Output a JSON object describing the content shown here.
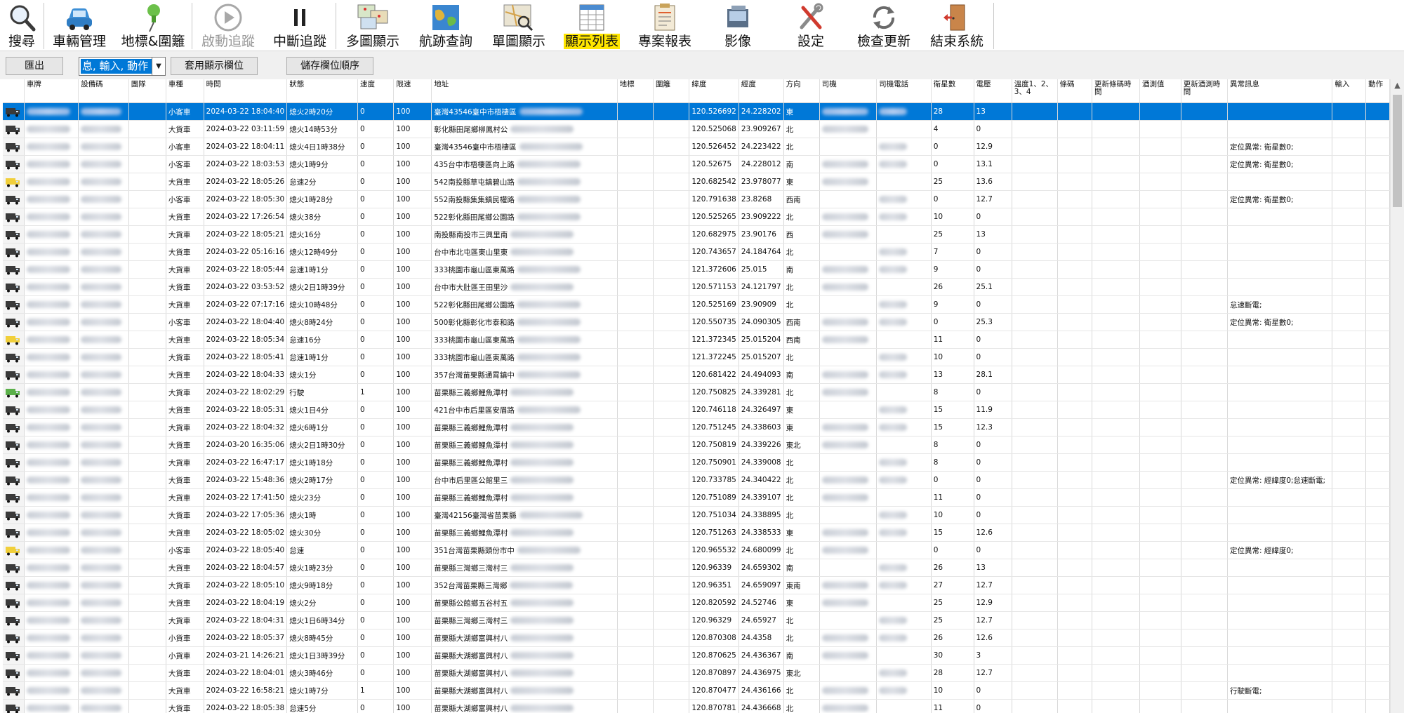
{
  "toolbar": {
    "buttons": [
      {
        "label": "搜尋",
        "icon": "search-icon",
        "state": "normal"
      },
      {
        "label": "車輛管理",
        "icon": "car-icon",
        "state": "normal"
      },
      {
        "label": "地標&圍籬",
        "icon": "pushpin-icon",
        "state": "normal"
      },
      {
        "label": "啟動追蹤",
        "icon": "play-icon",
        "state": "disabled"
      },
      {
        "label": "中斷追蹤",
        "icon": "pause-icon",
        "state": "normal"
      },
      {
        "label": "多圖顯示",
        "icon": "multi-map-icon",
        "state": "normal"
      },
      {
        "label": "航跡查詢",
        "icon": "globe-icon",
        "state": "normal"
      },
      {
        "label": "單圖顯示",
        "icon": "map-search-icon",
        "state": "normal"
      },
      {
        "label": "顯示列表",
        "icon": "table-icon",
        "state": "active"
      },
      {
        "label": "專案報表",
        "icon": "report-icon",
        "state": "normal"
      },
      {
        "label": "影像",
        "icon": "image-icon",
        "state": "normal"
      },
      {
        "label": "設定",
        "icon": "tools-icon",
        "state": "normal"
      },
      {
        "label": "檢查更新",
        "icon": "refresh-icon",
        "state": "normal"
      },
      {
        "label": "結束系統",
        "icon": "exit-door-icon",
        "state": "normal"
      }
    ],
    "accent_color": "#ffe600"
  },
  "subbar": {
    "export_label": "匯出",
    "column_select_value": "息, 輸入, 動作",
    "apply_columns_label": "套用顯示欄位",
    "save_order_label": "儲存欄位順序"
  },
  "grid": {
    "selection_color": "#0078d7",
    "columns": [
      "車牌",
      "設備碼",
      "團隊",
      "車種",
      "時間",
      "狀態",
      "速度",
      "限速",
      "地址",
      "地標",
      "圍籬",
      "緯度",
      "經度",
      "方向",
      "司機",
      "司機電話",
      "衛星數",
      "電壓",
      "溫度1、2、3、4",
      "條碼",
      "更新條碼時間",
      "酒測值",
      "更新酒測時間",
      "異常訊息",
      "輸入",
      "動作"
    ],
    "rows": [
      {
        "type": "小客車",
        "time": "2024-03-22 18:04:40",
        "status": "熄火2時20分",
        "speed": "0",
        "limit": "100",
        "addr": "臺灣43546臺中市梧棲區",
        "lng": "120.526692",
        "lat": "24.228202",
        "dir": "東",
        "sat": "28",
        "volt": "13",
        "err": "",
        "icon": "dark"
      },
      {
        "type": "大貨車",
        "time": "2024-03-22 03:11:59",
        "status": "熄火14時53分",
        "speed": "0",
        "limit": "100",
        "addr": "彰化縣田尾鄉柳鳳村公",
        "lng": "120.525068",
        "lat": "23.909267",
        "dir": "北",
        "sat": "4",
        "volt": "0",
        "err": "",
        "icon": "dark"
      },
      {
        "type": "小客車",
        "time": "2024-03-22 18:04:11",
        "status": "熄火4日1時38分",
        "speed": "0",
        "limit": "100",
        "addr": "臺灣43546臺中市梧棲區",
        "lng": "120.526452",
        "lat": "24.223422",
        "dir": "北",
        "sat": "0",
        "volt": "12.9",
        "err": "定位異常: 衛星數0;",
        "icon": "dark"
      },
      {
        "type": "小客車",
        "time": "2024-03-22 18:03:53",
        "status": "熄火1時9分",
        "speed": "0",
        "limit": "100",
        "addr": "435台中市梧棲區向上路",
        "lng": "120.52675",
        "lat": "24.228012",
        "dir": "南",
        "sat": "0",
        "volt": "13.1",
        "err": "定位異常: 衛星數0;",
        "icon": "dark"
      },
      {
        "type": "大貨車",
        "time": "2024-03-22 18:05:26",
        "status": "怠速2分",
        "speed": "0",
        "limit": "100",
        "addr": "542南投縣草屯鎮碧山路",
        "lng": "120.682542",
        "lat": "23.978077",
        "dir": "東",
        "sat": "25",
        "volt": "13.6",
        "err": "",
        "icon": "yellow"
      },
      {
        "type": "小客車",
        "time": "2024-03-22 18:05:30",
        "status": "熄火1時28分",
        "speed": "0",
        "limit": "100",
        "addr": "552南投縣集集鎮民權路",
        "lng": "120.791638",
        "lat": "23.8268",
        "dir": "西南",
        "sat": "0",
        "volt": "12.7",
        "err": "定位異常: 衛星數0;",
        "icon": "dark"
      },
      {
        "type": "大貨車",
        "time": "2024-03-22 17:26:54",
        "status": "熄火38分",
        "speed": "0",
        "limit": "100",
        "addr": "522彰化縣田尾鄉公園路",
        "lng": "120.525265",
        "lat": "23.909222",
        "dir": "北",
        "sat": "10",
        "volt": "0",
        "err": "",
        "icon": "dark"
      },
      {
        "type": "大貨車",
        "time": "2024-03-22 18:05:21",
        "status": "熄火16分",
        "speed": "0",
        "limit": "100",
        "addr": "南投縣南投市三興里南",
        "lng": "120.682975",
        "lat": "23.90176",
        "dir": "西",
        "sat": "25",
        "volt": "13",
        "err": "",
        "icon": "dark"
      },
      {
        "type": "大貨車",
        "time": "2024-03-22 05:16:16",
        "status": "熄火12時49分",
        "speed": "0",
        "limit": "100",
        "addr": "台中市北屯區東山里東",
        "lng": "120.743657",
        "lat": "24.184764",
        "dir": "北",
        "sat": "7",
        "volt": "0",
        "err": "",
        "icon": "dark"
      },
      {
        "type": "大貨車",
        "time": "2024-03-22 18:05:44",
        "status": "怠速1時1分",
        "speed": "0",
        "limit": "100",
        "addr": "333桃園市龜山區東萬路",
        "lng": "121.372606",
        "lat": "25.015",
        "dir": "南",
        "sat": "9",
        "volt": "0",
        "err": "",
        "icon": "dark"
      },
      {
        "type": "大貨車",
        "time": "2024-03-22 03:53:52",
        "status": "熄火2日1時39分",
        "speed": "0",
        "limit": "100",
        "addr": "台中市大肚區王田里沙",
        "lng": "120.571153",
        "lat": "24.121797",
        "dir": "北",
        "sat": "26",
        "volt": "25.1",
        "err": "",
        "icon": "dark"
      },
      {
        "type": "大貨車",
        "time": "2024-03-22 07:17:16",
        "status": "熄火10時48分",
        "speed": "0",
        "limit": "100",
        "addr": "522彰化縣田尾鄉公園路",
        "lng": "120.525169",
        "lat": "23.90909",
        "dir": "北",
        "sat": "9",
        "volt": "0",
        "err": "怠速斷電;",
        "icon": "dark"
      },
      {
        "type": "小客車",
        "time": "2024-03-22 18:04:40",
        "status": "熄火8時24分",
        "speed": "0",
        "limit": "100",
        "addr": "500彰化縣彰化市泰和路",
        "lng": "120.550735",
        "lat": "24.090305",
        "dir": "西南",
        "sat": "0",
        "volt": "25.3",
        "err": "定位異常: 衛星數0;",
        "icon": "dark"
      },
      {
        "type": "大貨車",
        "time": "2024-03-22 18:05:34",
        "status": "怠速16分",
        "speed": "0",
        "limit": "100",
        "addr": "333桃園市龜山區東萬路",
        "lng": "121.372345",
        "lat": "25.015204",
        "dir": "西南",
        "sat": "11",
        "volt": "0",
        "err": "",
        "icon": "yellow"
      },
      {
        "type": "大貨車",
        "time": "2024-03-22 18:05:41",
        "status": "怠速1時1分",
        "speed": "0",
        "limit": "100",
        "addr": "333桃園市龜山區東萬路",
        "lng": "121.372245",
        "lat": "25.015207",
        "dir": "北",
        "sat": "10",
        "volt": "0",
        "err": "",
        "icon": "dark"
      },
      {
        "type": "大貨車",
        "time": "2024-03-22 18:04:33",
        "status": "熄火1分",
        "speed": "0",
        "limit": "100",
        "addr": "357台灣苗栗縣通霄鎮中",
        "lng": "120.681422",
        "lat": "24.494093",
        "dir": "南",
        "sat": "13",
        "volt": "28.1",
        "err": "",
        "icon": "dark"
      },
      {
        "type": "大貨車",
        "time": "2024-03-22 18:02:29",
        "status": "行駛",
        "speed": "1",
        "limit": "100",
        "addr": "苗栗縣三義鄉鯉魚潭村",
        "lng": "120.750825",
        "lat": "24.339281",
        "dir": "北",
        "sat": "8",
        "volt": "0",
        "err": "",
        "icon": "green"
      },
      {
        "type": "大貨車",
        "time": "2024-03-22 18:05:31",
        "status": "熄火1日4分",
        "speed": "0",
        "limit": "100",
        "addr": "421台中市后里區安眉路",
        "lng": "120.746118",
        "lat": "24.326497",
        "dir": "東",
        "sat": "15",
        "volt": "11.9",
        "err": "",
        "icon": "dark"
      },
      {
        "type": "大貨車",
        "time": "2024-03-22 18:04:32",
        "status": "熄火6時1分",
        "speed": "0",
        "limit": "100",
        "addr": "苗栗縣三義鄉鯉魚潭村",
        "lng": "120.751245",
        "lat": "24.338603",
        "dir": "東",
        "sat": "15",
        "volt": "12.3",
        "err": "",
        "icon": "dark"
      },
      {
        "type": "大貨車",
        "time": "2024-03-20 16:35:06",
        "status": "熄火2日1時30分",
        "speed": "0",
        "limit": "100",
        "addr": "苗栗縣三義鄉鯉魚潭村",
        "lng": "120.750819",
        "lat": "24.339226",
        "dir": "東北",
        "sat": "8",
        "volt": "0",
        "err": "",
        "icon": "dark"
      },
      {
        "type": "大貨車",
        "time": "2024-03-22 16:47:17",
        "status": "熄火1時18分",
        "speed": "0",
        "limit": "100",
        "addr": "苗栗縣三義鄉鯉魚潭村",
        "lng": "120.750901",
        "lat": "24.339008",
        "dir": "北",
        "sat": "8",
        "volt": "0",
        "err": "",
        "icon": "dark"
      },
      {
        "type": "大貨車",
        "time": "2024-03-22 15:48:36",
        "status": "熄火2時17分",
        "speed": "0",
        "limit": "100",
        "addr": "台中市后里區公館里三",
        "lng": "120.733785",
        "lat": "24.340422",
        "dir": "北",
        "sat": "0",
        "volt": "0",
        "err": "定位異常: 經緯度0;怠速斷電;",
        "icon": "dark"
      },
      {
        "type": "大貨車",
        "time": "2024-03-22 17:41:50",
        "status": "熄火23分",
        "speed": "0",
        "limit": "100",
        "addr": "苗栗縣三義鄉鯉魚潭村",
        "lng": "120.751089",
        "lat": "24.339107",
        "dir": "北",
        "sat": "11",
        "volt": "0",
        "err": "",
        "icon": "dark"
      },
      {
        "type": "大貨車",
        "time": "2024-03-22 17:05:36",
        "status": "熄火1時",
        "speed": "0",
        "limit": "100",
        "addr": "臺灣42156臺灣省苗栗縣",
        "lng": "120.751034",
        "lat": "24.338895",
        "dir": "北",
        "sat": "10",
        "volt": "0",
        "err": "",
        "icon": "dark"
      },
      {
        "type": "大貨車",
        "time": "2024-03-22 18:05:02",
        "status": "熄火30分",
        "speed": "0",
        "limit": "100",
        "addr": "苗栗縣三義鄉鯉魚潭村",
        "lng": "120.751263",
        "lat": "24.338533",
        "dir": "東",
        "sat": "15",
        "volt": "12.6",
        "err": "",
        "icon": "dark"
      },
      {
        "type": "小客車",
        "time": "2024-03-22 18:05:40",
        "status": "怠速",
        "speed": "0",
        "limit": "100",
        "addr": "351台灣苗栗縣頭份市中",
        "lng": "120.965532",
        "lat": "24.680099",
        "dir": "北",
        "sat": "0",
        "volt": "0",
        "err": "定位異常: 經緯度0;",
        "icon": "yellow"
      },
      {
        "type": "大貨車",
        "time": "2024-03-22 18:04:57",
        "status": "熄火1時23分",
        "speed": "0",
        "limit": "100",
        "addr": "苗栗縣三灣鄉三灣村三",
        "lng": "120.96339",
        "lat": "24.659302",
        "dir": "南",
        "sat": "26",
        "volt": "13",
        "err": "",
        "icon": "dark"
      },
      {
        "type": "大貨車",
        "time": "2024-03-22 18:05:10",
        "status": "熄火9時18分",
        "speed": "0",
        "limit": "100",
        "addr": "352台灣苗栗縣三灣鄉",
        "lng": "120.96351",
        "lat": "24.659097",
        "dir": "東南",
        "sat": "27",
        "volt": "12.7",
        "err": "",
        "icon": "dark"
      },
      {
        "type": "大貨車",
        "time": "2024-03-22 18:04:19",
        "status": "熄火2分",
        "speed": "0",
        "limit": "100",
        "addr": "苗栗縣公館鄉五谷村五",
        "lng": "120.820592",
        "lat": "24.52746",
        "dir": "東",
        "sat": "25",
        "volt": "12.9",
        "err": "",
        "icon": "dark"
      },
      {
        "type": "大貨車",
        "time": "2024-03-22 18:04:31",
        "status": "熄火1日6時34分",
        "speed": "0",
        "limit": "100",
        "addr": "苗栗縣三灣鄉三灣村三",
        "lng": "120.96329",
        "lat": "24.65927",
        "dir": "北",
        "sat": "25",
        "volt": "12.7",
        "err": "",
        "icon": "dark"
      },
      {
        "type": "小貨車",
        "time": "2024-03-22 18:05:37",
        "status": "熄火8時45分",
        "speed": "0",
        "limit": "100",
        "addr": "苗栗縣大湖鄉富興村八",
        "lng": "120.870308",
        "lat": "24.4358",
        "dir": "北",
        "sat": "26",
        "volt": "12.6",
        "err": "",
        "icon": "dark"
      },
      {
        "type": "小貨車",
        "time": "2024-03-21 14:26:21",
        "status": "熄火1日3時39分",
        "speed": "0",
        "limit": "100",
        "addr": "苗栗縣大湖鄉富興村八",
        "lng": "120.870625",
        "lat": "24.436367",
        "dir": "南",
        "sat": "30",
        "volt": "3",
        "err": "",
        "icon": "dark"
      },
      {
        "type": "大貨車",
        "time": "2024-03-22 18:04:01",
        "status": "熄火3時46分",
        "speed": "0",
        "limit": "100",
        "addr": "苗栗縣大湖鄉富興村八",
        "lng": "120.870897",
        "lat": "24.436975",
        "dir": "東北",
        "sat": "28",
        "volt": "12.7",
        "err": "",
        "icon": "dark"
      },
      {
        "type": "大貨車",
        "time": "2024-03-22 16:58:21",
        "status": "熄火1時7分",
        "speed": "1",
        "limit": "100",
        "addr": "苗栗縣大湖鄉富興村八",
        "lng": "120.870477",
        "lat": "24.436166",
        "dir": "北",
        "sat": "10",
        "volt": "0",
        "err": "行駛斷電;",
        "icon": "dark"
      },
      {
        "type": "大貨車",
        "time": "2024-03-22 18:05:38",
        "status": "怠速5分",
        "speed": "0",
        "limit": "100",
        "addr": "苗栗縣大湖鄉富興村八",
        "lng": "120.870781",
        "lat": "24.436668",
        "dir": "北",
        "sat": "11",
        "volt": "0",
        "err": "",
        "icon": "dark"
      }
    ]
  }
}
